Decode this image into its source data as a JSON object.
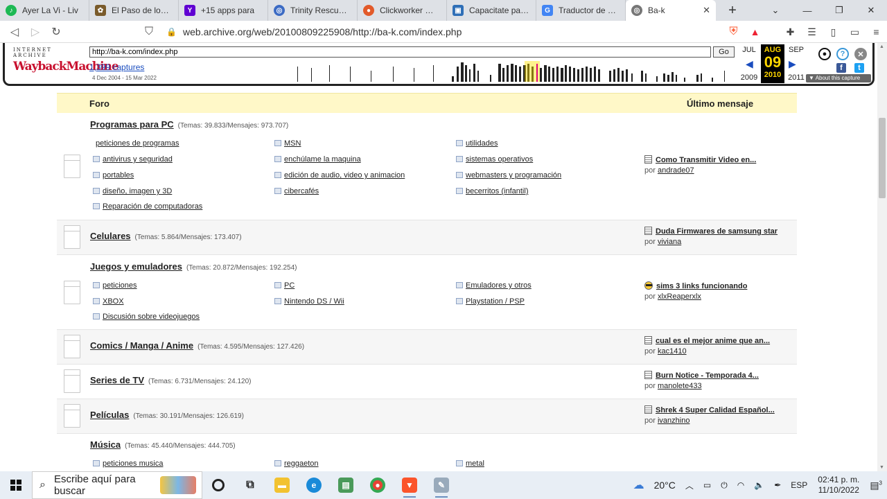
{
  "browser": {
    "tabs": [
      {
        "label": "Ayer La Vi - Liv",
        "favicon": "spotify-icon",
        "color": "#1db954"
      },
      {
        "label": "El Paso de los Año",
        "favicon": "forum-icon",
        "color": "#7a5b2b"
      },
      {
        "label": "+15 apps para",
        "favicon": "yahoo-icon",
        "color": "#6001d2"
      },
      {
        "label": "Trinity Rescue Kit",
        "favicon": "globe-icon",
        "color": "#3c6bc4"
      },
      {
        "label": "Clickworker Workp",
        "favicon": "chrome-icon",
        "color": "#e25a2a"
      },
      {
        "label": "Capacitate para el",
        "favicon": "doc-icon",
        "color": "#2f6fb7"
      },
      {
        "label": "Traductor de Goog",
        "favicon": "translate-icon",
        "color": "#4285f4"
      }
    ],
    "active_tab": {
      "label": "Ba-k",
      "close": "✕"
    },
    "new_tab": "+",
    "url": "web.archive.org/web/20100809225908/http://ba-k.com/index.php"
  },
  "wayback": {
    "logo_top": "INTERNET ARCHIVE",
    "logo_main": "WaybackMachine",
    "url_value": "http://ba-k.com/index.php",
    "go": "Go",
    "captures": "1,399 captures",
    "range": "4 Dec 2004 - 15 Mar 2022",
    "prev_month": "JUL",
    "cur_month": "AUG",
    "cur_day": "09",
    "next_month": "SEP",
    "prev_year": "2009",
    "cur_year": "2010",
    "next_year": "2011",
    "about": "▼ About this capture"
  },
  "forum": {
    "faded": "Desca",
    "col_forum": "Foro",
    "col_last": "Último mensaje",
    "sections": [
      {
        "title": "Programas para PC",
        "stats": "(Temas: 39.833/Mensajes: 973.707)",
        "subforums": [
          "peticiones de programas",
          "MSN",
          "utilidades",
          "antivirus y seguridad",
          "enchúlame la maquina",
          "sistemas operativos",
          "portables",
          "edición de audio, video y animacion",
          "webmasters y programación",
          "diseño, imagen y 3D",
          "cibercafés",
          "becerritos (infantil)",
          "Reparación de computadoras"
        ],
        "last_title": "Como Transmitir Video en...",
        "last_by": "por",
        "last_user": "andrade07"
      },
      {
        "title": "Celulares",
        "stats": "(Temas: 5.864/Mensajes: 173.407)",
        "last_title": "Duda Firmwares de samsung star",
        "last_by": "por",
        "last_user": "viviana"
      },
      {
        "title": "Juegos y emuladores",
        "stats": "(Temas: 20.872/Mensajes: 192.254)",
        "subforums": [
          "peticiones",
          "PC",
          "Emuladores y otros",
          "XBOX",
          "Nintendo DS / Wii",
          "Playstation / PSP",
          "Discusión sobre videojuegos"
        ],
        "last_title": "sims 3 links funcionando",
        "last_by": "por",
        "last_user": "xlxReaperxlx"
      },
      {
        "title": "Comics / Manga / Anime",
        "stats": "(Temas: 4.595/Mensajes: 127.426)",
        "last_title": "cual es el mejor anime que an...",
        "last_by": "por",
        "last_user": "kac1410"
      },
      {
        "title": "Series de TV",
        "stats": "(Temas: 6.731/Mensajes: 24.120)",
        "last_title": "Burn Notice - Temporada 4...",
        "last_by": "por",
        "last_user": "manolete433"
      },
      {
        "title": "Películas",
        "stats": "(Temas: 30.191/Mensajes: 126.619)",
        "last_title": "Shrek 4 Super Calidad Español...",
        "last_by": "por",
        "last_user": "ivanzhino"
      },
      {
        "title": "Música",
        "stats": "(Temas: 45.440/Mensajes: 444.705)",
        "subforums": [
          "peticiones musica",
          "reggaeton",
          "metal"
        ]
      }
    ]
  },
  "taskbar": {
    "search_placeholder": "Escribe aquí para buscar",
    "weather": "20°C",
    "lang": "ESP",
    "time": "02:41 p. m.",
    "date": "11/10/2022",
    "notifications": "3"
  }
}
